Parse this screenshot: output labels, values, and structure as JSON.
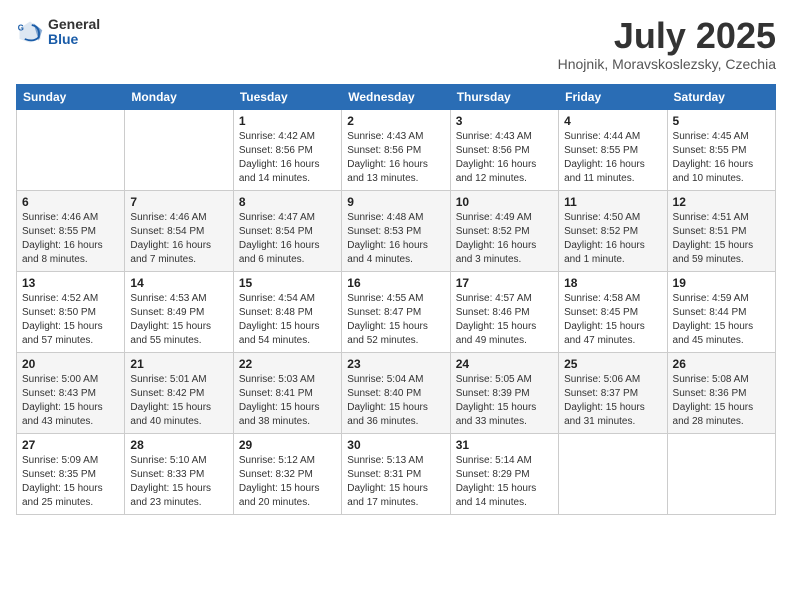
{
  "header": {
    "logo_line1": "General",
    "logo_line2": "Blue",
    "month": "July 2025",
    "location": "Hnojnik, Moravskoslezsky, Czechia"
  },
  "weekdays": [
    "Sunday",
    "Monday",
    "Tuesday",
    "Wednesday",
    "Thursday",
    "Friday",
    "Saturday"
  ],
  "weeks": [
    [
      {
        "day": "",
        "info": ""
      },
      {
        "day": "",
        "info": ""
      },
      {
        "day": "1",
        "info": "Sunrise: 4:42 AM\nSunset: 8:56 PM\nDaylight: 16 hours and 14 minutes."
      },
      {
        "day": "2",
        "info": "Sunrise: 4:43 AM\nSunset: 8:56 PM\nDaylight: 16 hours and 13 minutes."
      },
      {
        "day": "3",
        "info": "Sunrise: 4:43 AM\nSunset: 8:56 PM\nDaylight: 16 hours and 12 minutes."
      },
      {
        "day": "4",
        "info": "Sunrise: 4:44 AM\nSunset: 8:55 PM\nDaylight: 16 hours and 11 minutes."
      },
      {
        "day": "5",
        "info": "Sunrise: 4:45 AM\nSunset: 8:55 PM\nDaylight: 16 hours and 10 minutes."
      }
    ],
    [
      {
        "day": "6",
        "info": "Sunrise: 4:46 AM\nSunset: 8:55 PM\nDaylight: 16 hours and 8 minutes."
      },
      {
        "day": "7",
        "info": "Sunrise: 4:46 AM\nSunset: 8:54 PM\nDaylight: 16 hours and 7 minutes."
      },
      {
        "day": "8",
        "info": "Sunrise: 4:47 AM\nSunset: 8:54 PM\nDaylight: 16 hours and 6 minutes."
      },
      {
        "day": "9",
        "info": "Sunrise: 4:48 AM\nSunset: 8:53 PM\nDaylight: 16 hours and 4 minutes."
      },
      {
        "day": "10",
        "info": "Sunrise: 4:49 AM\nSunset: 8:52 PM\nDaylight: 16 hours and 3 minutes."
      },
      {
        "day": "11",
        "info": "Sunrise: 4:50 AM\nSunset: 8:52 PM\nDaylight: 16 hours and 1 minute."
      },
      {
        "day": "12",
        "info": "Sunrise: 4:51 AM\nSunset: 8:51 PM\nDaylight: 15 hours and 59 minutes."
      }
    ],
    [
      {
        "day": "13",
        "info": "Sunrise: 4:52 AM\nSunset: 8:50 PM\nDaylight: 15 hours and 57 minutes."
      },
      {
        "day": "14",
        "info": "Sunrise: 4:53 AM\nSunset: 8:49 PM\nDaylight: 15 hours and 55 minutes."
      },
      {
        "day": "15",
        "info": "Sunrise: 4:54 AM\nSunset: 8:48 PM\nDaylight: 15 hours and 54 minutes."
      },
      {
        "day": "16",
        "info": "Sunrise: 4:55 AM\nSunset: 8:47 PM\nDaylight: 15 hours and 52 minutes."
      },
      {
        "day": "17",
        "info": "Sunrise: 4:57 AM\nSunset: 8:46 PM\nDaylight: 15 hours and 49 minutes."
      },
      {
        "day": "18",
        "info": "Sunrise: 4:58 AM\nSunset: 8:45 PM\nDaylight: 15 hours and 47 minutes."
      },
      {
        "day": "19",
        "info": "Sunrise: 4:59 AM\nSunset: 8:44 PM\nDaylight: 15 hours and 45 minutes."
      }
    ],
    [
      {
        "day": "20",
        "info": "Sunrise: 5:00 AM\nSunset: 8:43 PM\nDaylight: 15 hours and 43 minutes."
      },
      {
        "day": "21",
        "info": "Sunrise: 5:01 AM\nSunset: 8:42 PM\nDaylight: 15 hours and 40 minutes."
      },
      {
        "day": "22",
        "info": "Sunrise: 5:03 AM\nSunset: 8:41 PM\nDaylight: 15 hours and 38 minutes."
      },
      {
        "day": "23",
        "info": "Sunrise: 5:04 AM\nSunset: 8:40 PM\nDaylight: 15 hours and 36 minutes."
      },
      {
        "day": "24",
        "info": "Sunrise: 5:05 AM\nSunset: 8:39 PM\nDaylight: 15 hours and 33 minutes."
      },
      {
        "day": "25",
        "info": "Sunrise: 5:06 AM\nSunset: 8:37 PM\nDaylight: 15 hours and 31 minutes."
      },
      {
        "day": "26",
        "info": "Sunrise: 5:08 AM\nSunset: 8:36 PM\nDaylight: 15 hours and 28 minutes."
      }
    ],
    [
      {
        "day": "27",
        "info": "Sunrise: 5:09 AM\nSunset: 8:35 PM\nDaylight: 15 hours and 25 minutes."
      },
      {
        "day": "28",
        "info": "Sunrise: 5:10 AM\nSunset: 8:33 PM\nDaylight: 15 hours and 23 minutes."
      },
      {
        "day": "29",
        "info": "Sunrise: 5:12 AM\nSunset: 8:32 PM\nDaylight: 15 hours and 20 minutes."
      },
      {
        "day": "30",
        "info": "Sunrise: 5:13 AM\nSunset: 8:31 PM\nDaylight: 15 hours and 17 minutes."
      },
      {
        "day": "31",
        "info": "Sunrise: 5:14 AM\nSunset: 8:29 PM\nDaylight: 15 hours and 14 minutes."
      },
      {
        "day": "",
        "info": ""
      },
      {
        "day": "",
        "info": ""
      }
    ]
  ]
}
